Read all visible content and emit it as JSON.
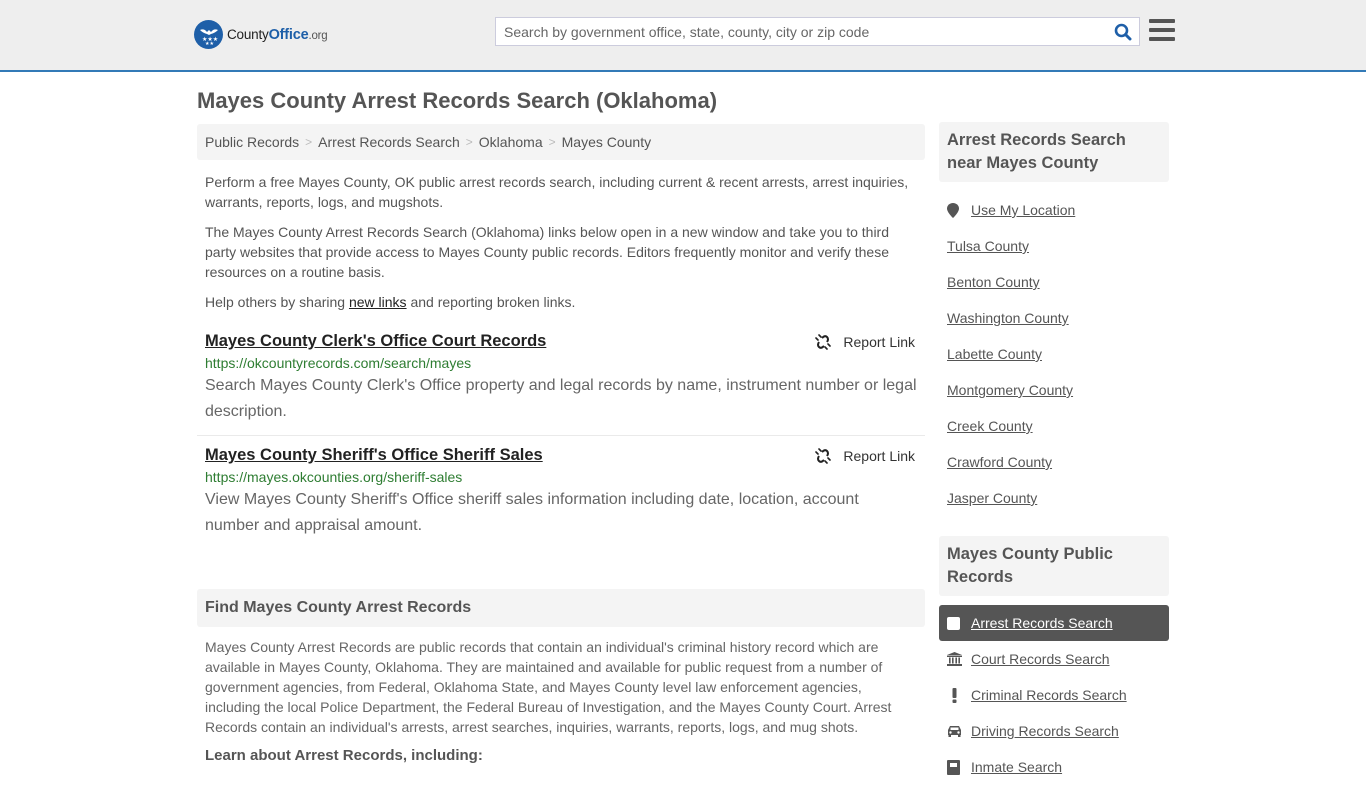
{
  "header": {
    "logo": {
      "county": "County",
      "office": "Office",
      "org": ".org"
    },
    "search": {
      "placeholder": "Search by government office, state, county, city or zip code",
      "value": ""
    },
    "colors": {
      "brand": "#1e5fa8",
      "header_border": "#337ab7",
      "url_green": "#2e7d32"
    }
  },
  "page": {
    "title": "Mayes County Arrest Records Search (Oklahoma)"
  },
  "breadcrumb": [
    {
      "label": "Public Records"
    },
    {
      "label": "Arrest Records Search"
    },
    {
      "label": "Oklahoma"
    },
    {
      "label": "Mayes County"
    }
  ],
  "breadcrumb_separator": ">",
  "intro": {
    "p1": "Perform a free Mayes County, OK public arrest records search, including current & recent arrests, arrest inquiries, warrants, reports, logs, and mugshots.",
    "p2": "The Mayes County Arrest Records Search (Oklahoma) links below open in a new window and take you to third party websites that provide access to Mayes County public records. Editors frequently monitor and verify these resources on a routine basis.",
    "p3_before": "Help others by sharing ",
    "p3_link": "new links",
    "p3_after": " and reporting broken links."
  },
  "results": [
    {
      "title": "Mayes County Clerk's Office Court Records",
      "url": "https://okcountyrecords.com/search/mayes",
      "description": "Search Mayes County Clerk's Office property and legal records by name, instrument number or legal description.",
      "report_label": "Report Link"
    },
    {
      "title": "Mayes County Sheriff's Office Sheriff Sales",
      "url": "https://mayes.okcounties.org/sheriff-sales",
      "description": "View Mayes County Sheriff's Office sheriff sales information including date, location, account number and appraisal amount.",
      "report_label": "Report Link"
    }
  ],
  "find_section": {
    "heading": "Find Mayes County Arrest Records",
    "body": "Mayes County Arrest Records are public records that contain an individual's criminal history record which are available in Mayes County, Oklahoma. They are maintained and available for public request from a number of government agencies, from Federal, Oklahoma State, and Mayes County level law enforcement agencies, including the local Police Department, the Federal Bureau of Investigation, and the Mayes County Court. Arrest Records contain an individual's arrests, arrest searches, inquiries, warrants, reports, logs, and mug shots.",
    "subheading": "Learn about Arrest Records, including:"
  },
  "sidebar": {
    "nearby": {
      "heading": "Arrest Records Search near Mayes County",
      "use_location": {
        "label": "Use My Location",
        "icon": "map-marker-icon"
      },
      "items": [
        {
          "label": "Tulsa County"
        },
        {
          "label": "Benton County"
        },
        {
          "label": "Washington County"
        },
        {
          "label": "Labette County"
        },
        {
          "label": "Montgomery County"
        },
        {
          "label": "Creek County"
        },
        {
          "label": "Crawford County"
        },
        {
          "label": "Jasper County"
        }
      ]
    },
    "public_records": {
      "heading": "Mayes County Public Records",
      "items": [
        {
          "label": "Arrest Records Search",
          "icon": "square-icon",
          "active": true
        },
        {
          "label": "Court Records Search",
          "icon": "courthouse-icon",
          "active": false
        },
        {
          "label": "Criminal Records Search",
          "icon": "exclamation-icon",
          "active": false
        },
        {
          "label": "Driving Records Search",
          "icon": "car-icon",
          "active": false
        },
        {
          "label": "Inmate Search",
          "icon": "inmate-icon",
          "active": false
        }
      ]
    }
  }
}
